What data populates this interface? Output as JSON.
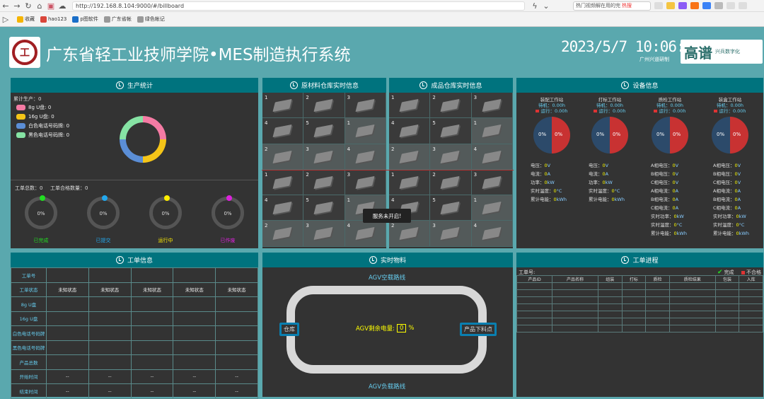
{
  "browser": {
    "url": "http://192.168.8.104:9000/#/billboard",
    "search": "热门视频解在用的完",
    "search_badge": "热搜",
    "bookmarks": [
      "收藏",
      "hao123",
      "p图软件",
      "广东省帐",
      "绿色帐记"
    ]
  },
  "header": {
    "title": "广东省轻工业技师学院•MES制造执行系统",
    "clock": "2023/5/7 10:06:28",
    "subtitle": "广州兴道研制",
    "brand_main": "高谱",
    "brand_sub": "兴兵数字化",
    "logo_char": "工"
  },
  "production": {
    "title": "生产统计",
    "total": "累计生产：0",
    "legend": [
      {
        "label": "8g U盘: 0",
        "color": "#f57ba4"
      },
      {
        "label": "16g U盘: 0",
        "color": "#f5c518"
      },
      {
        "label": "白色电话号码牌: 0",
        "color": "#5b8ed6"
      },
      {
        "label": "黑色电话号码牌: 0",
        "color": "#86e3a4"
      }
    ],
    "order_total": "工单总数：0",
    "order_qualified": "工单合格数量：0",
    "gauges": [
      {
        "label": "已完成",
        "value": "0%",
        "color": "#22dd22"
      },
      {
        "label": "已提交",
        "value": "0%",
        "color": "#22a8ee"
      },
      {
        "label": "运行中",
        "value": "0%",
        "color": "#ffee00"
      },
      {
        "label": "已作废",
        "value": "0%",
        "color": "#dd22dd"
      }
    ]
  },
  "raw": {
    "title": "原材料仓库实时信息",
    "cells": [
      "1",
      "2",
      "3",
      "4",
      "5",
      "1",
      "2",
      "3",
      "4",
      "1",
      "2",
      "3",
      "4",
      "5",
      "1",
      "2",
      "3",
      "4"
    ]
  },
  "finished": {
    "title": "成品仓库实时信息",
    "cells": [
      "1",
      "2",
      "3",
      "4",
      "5",
      "1",
      "2",
      "3",
      "4",
      "1",
      "2",
      "3",
      "4",
      "5",
      "1",
      "2",
      "3",
      "4"
    ]
  },
  "tooltip": "服务未开启!",
  "equipment": {
    "title": "设备信息",
    "stations": [
      {
        "name": "装配工作站",
        "idle": "待机：0.00h",
        "run": "运行：0.00h",
        "p1": "0%",
        "p2": "0%"
      },
      {
        "name": "打标工作站",
        "idle": "待机：0.00h",
        "run": "运行：0.00h",
        "p1": "0%",
        "p2": "0%"
      },
      {
        "name": "质检工作站",
        "idle": "待机：0.00h",
        "run": "运行：0.00h",
        "p1": "0%",
        "p2": "0%"
      },
      {
        "name": "装盒工作站",
        "idle": "待机：0.00h",
        "run": "运行：0.00h",
        "p1": "0%",
        "p2": "0%"
      }
    ],
    "col1": [
      [
        "电压：",
        "0",
        "V"
      ],
      [
        "电流：",
        "0",
        "A"
      ],
      [
        "功率：",
        "0",
        "kW"
      ],
      [
        "实时温度：",
        "0",
        "°C"
      ],
      [
        "累计电能：",
        "0",
        "kWh"
      ]
    ],
    "col3": [
      [
        "A相电压：",
        "0",
        "V"
      ],
      [
        "B相电压：",
        "0",
        "V"
      ],
      [
        "C相电压：",
        "0",
        "V"
      ],
      [
        "A相电流：",
        "0",
        "A"
      ],
      [
        "B相电流：",
        "0",
        "A"
      ],
      [
        "C相电流：",
        "0",
        "A"
      ],
      [
        "实时功率：",
        "0",
        "kW"
      ],
      [
        "实时温度：",
        "0",
        "°C"
      ],
      [
        "累计电能：",
        "0",
        "kWh"
      ]
    ]
  },
  "workorder": {
    "title": "工单信息",
    "rows": [
      "工单号",
      "工单状态",
      "8g U盘",
      "16g U盘",
      "白色电话号码牌",
      "黑色电话号码牌",
      "产品总数",
      "开始时间",
      "结束时间"
    ],
    "status": "未知状态",
    "dash": "--"
  },
  "material": {
    "title": "实时物料",
    "top_route": "AGV空载路线",
    "bottom_route": "AGV负载路线",
    "warehouse": "仓库",
    "unload": "产品下料点",
    "battery_label": "AGV剩余电量:",
    "battery_value": "0",
    "battery_unit": "%"
  },
  "progress": {
    "title": "工单进程",
    "order_label": "工单号:",
    "complete": "完成",
    "fail": "不合格",
    "columns": [
      "产品ID",
      "产品名称",
      "组装",
      "打标",
      "质检",
      "质检结果",
      "包装",
      "入库"
    ]
  }
}
